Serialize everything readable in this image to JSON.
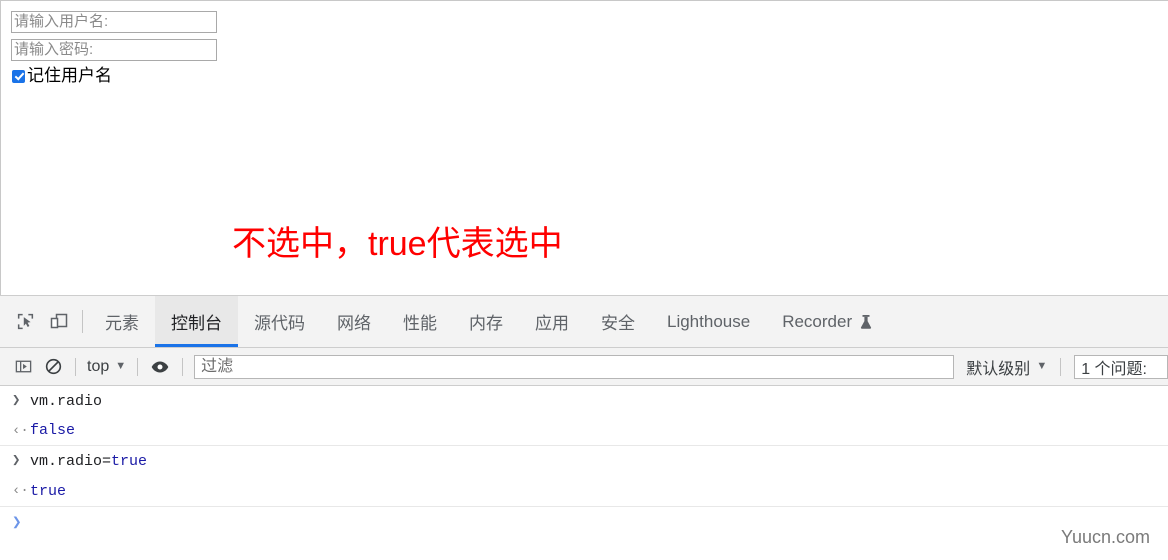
{
  "page": {
    "username_input": {
      "placeholder": "请输入用户名:",
      "value": ""
    },
    "password_input": {
      "placeholder": "请输入密码:",
      "value": ""
    },
    "remember_checkbox": {
      "label": "记住用户名",
      "checked": true
    },
    "annotation": {
      "text": "不选中，true代表选中",
      "color": "#ff0000"
    }
  },
  "devtools": {
    "tabs": [
      {
        "label": "元素",
        "active": false
      },
      {
        "label": "控制台",
        "active": true
      },
      {
        "label": "源代码",
        "active": false
      },
      {
        "label": "网络",
        "active": false
      },
      {
        "label": "性能",
        "active": false
      },
      {
        "label": "内存",
        "active": false
      },
      {
        "label": "应用",
        "active": false
      },
      {
        "label": "安全",
        "active": false
      },
      {
        "label": "Lighthouse",
        "active": false
      },
      {
        "label": "Recorder",
        "active": false,
        "icon": "flask-icon"
      }
    ],
    "toolbar_icons": {
      "inspect": "inspect-cursor-icon",
      "device": "device-toolbar-icon"
    },
    "console_toolbar": {
      "sidebar_toggle": "console-sidebar-icon",
      "clear_console": "clear-console-icon",
      "context": "top",
      "context_caret": "▼",
      "eye": "live-expression-icon",
      "filter_placeholder": "过滤",
      "filter_value": "",
      "level": "默认级别",
      "level_caret": "▼",
      "issues_label": "1 个问题:",
      "issues_badge": "",
      "accent": "#1a73e8"
    },
    "console_entries": [
      {
        "kind": "input",
        "marker": "❯",
        "text": "vm.radio"
      },
      {
        "kind": "output",
        "marker": "‹·",
        "text": "false"
      },
      {
        "kind": "input",
        "marker": "❯",
        "text": "vm.radio=",
        "token": "true"
      },
      {
        "kind": "output",
        "marker": "‹·",
        "text": "true"
      }
    ],
    "prompt": {
      "caret": "❯",
      "value": "",
      "placeholder": ""
    }
  },
  "watermark": {
    "text": "Yuucn.com"
  }
}
